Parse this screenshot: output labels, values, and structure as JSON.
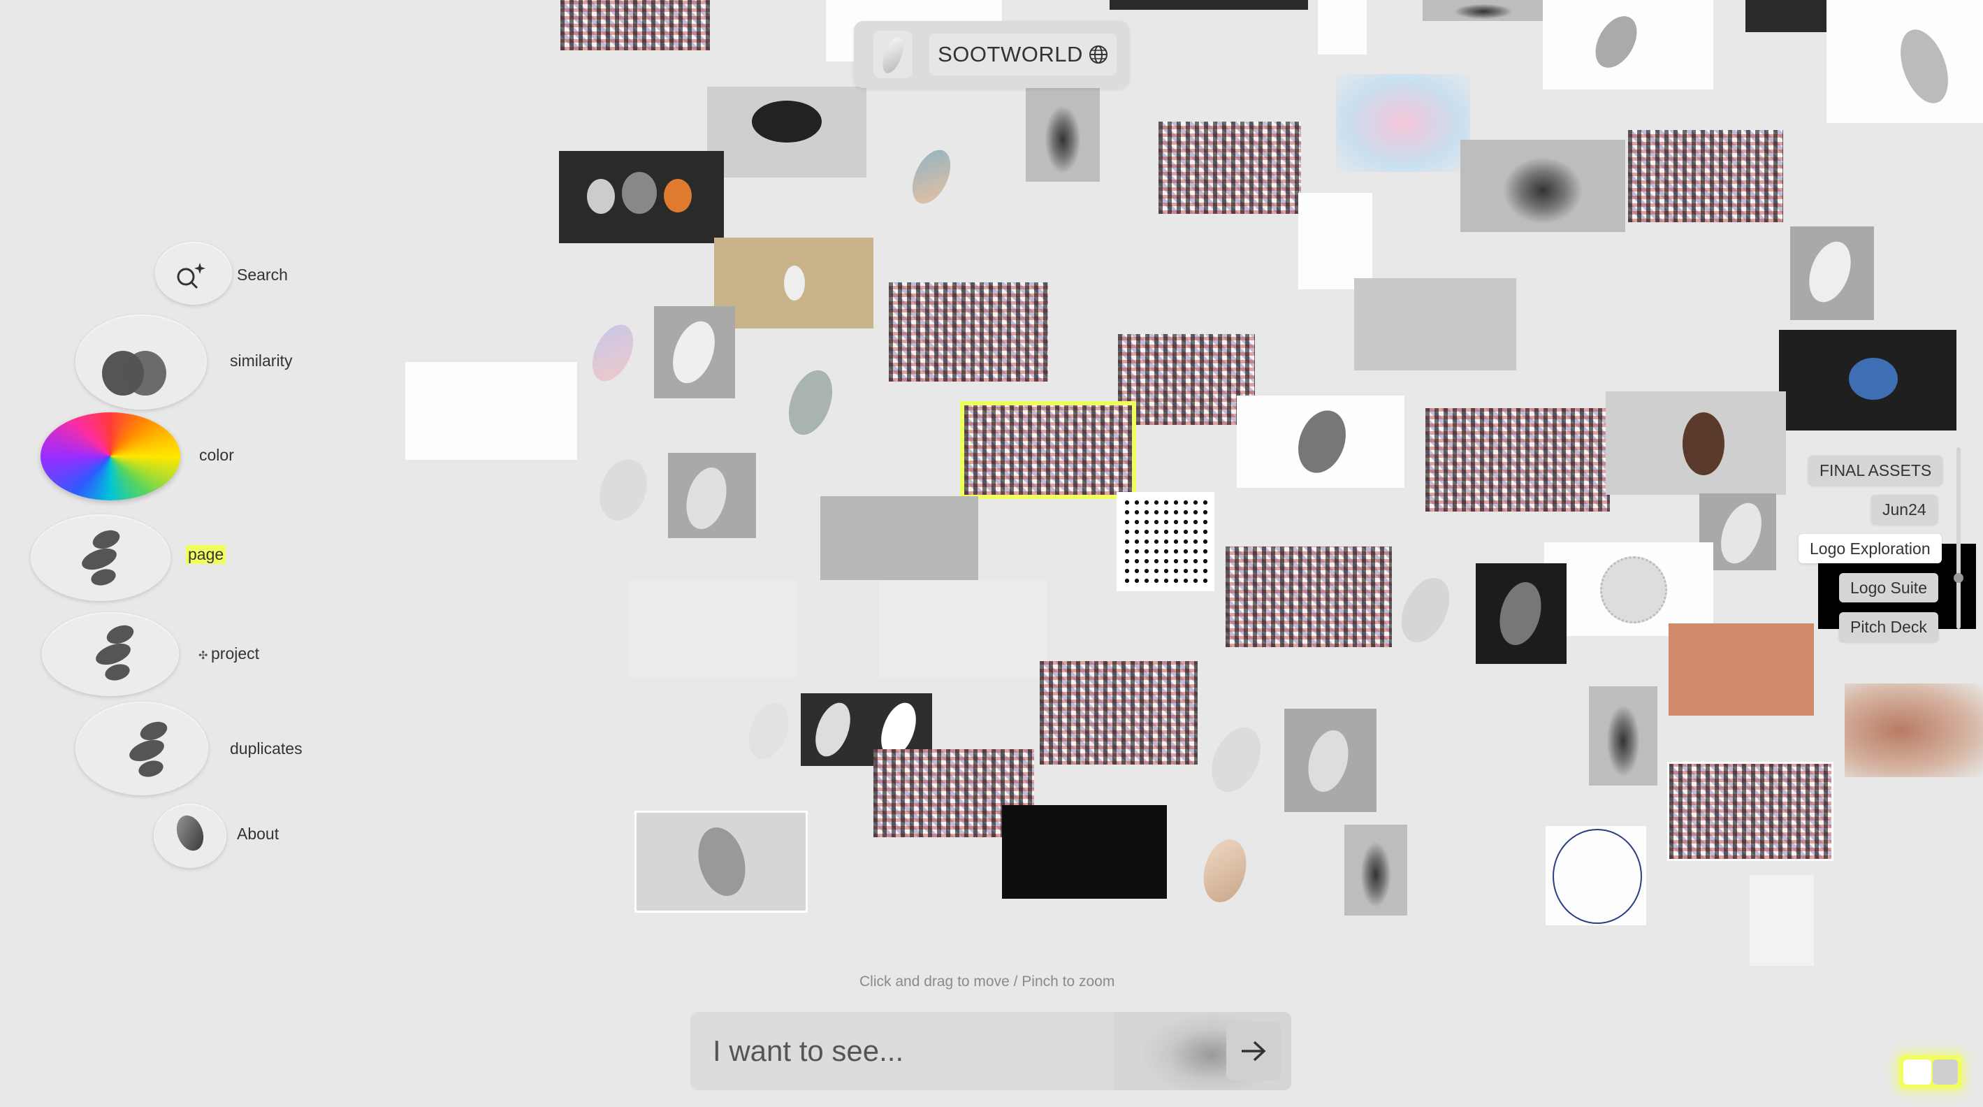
{
  "app": {
    "title": "SOOTWORLD"
  },
  "sidebar": {
    "items": [
      {
        "label": "Search"
      },
      {
        "label": "similarity"
      },
      {
        "label": "color"
      },
      {
        "label": "page"
      },
      {
        "label": "project"
      },
      {
        "label": "duplicates"
      },
      {
        "label": "About"
      }
    ],
    "active_item": "page"
  },
  "tags": [
    "FINAL ASSETS",
    "Jun24",
    "Logo Exploration",
    "Logo Suite",
    "Pitch Deck"
  ],
  "active_tag": "Logo Exploration",
  "canvas": {
    "hint": "Click and drag to move / Pinch to zoom"
  },
  "prompt": {
    "placeholder": "I want to see..."
  },
  "colors": {
    "accent": "#f1ff5e",
    "background": "#e8e8e8"
  },
  "icons": [
    "search-sparkle-icon",
    "globe-icon",
    "arrow-right-icon",
    "color-wheel-icon",
    "pebbles-icon"
  ]
}
